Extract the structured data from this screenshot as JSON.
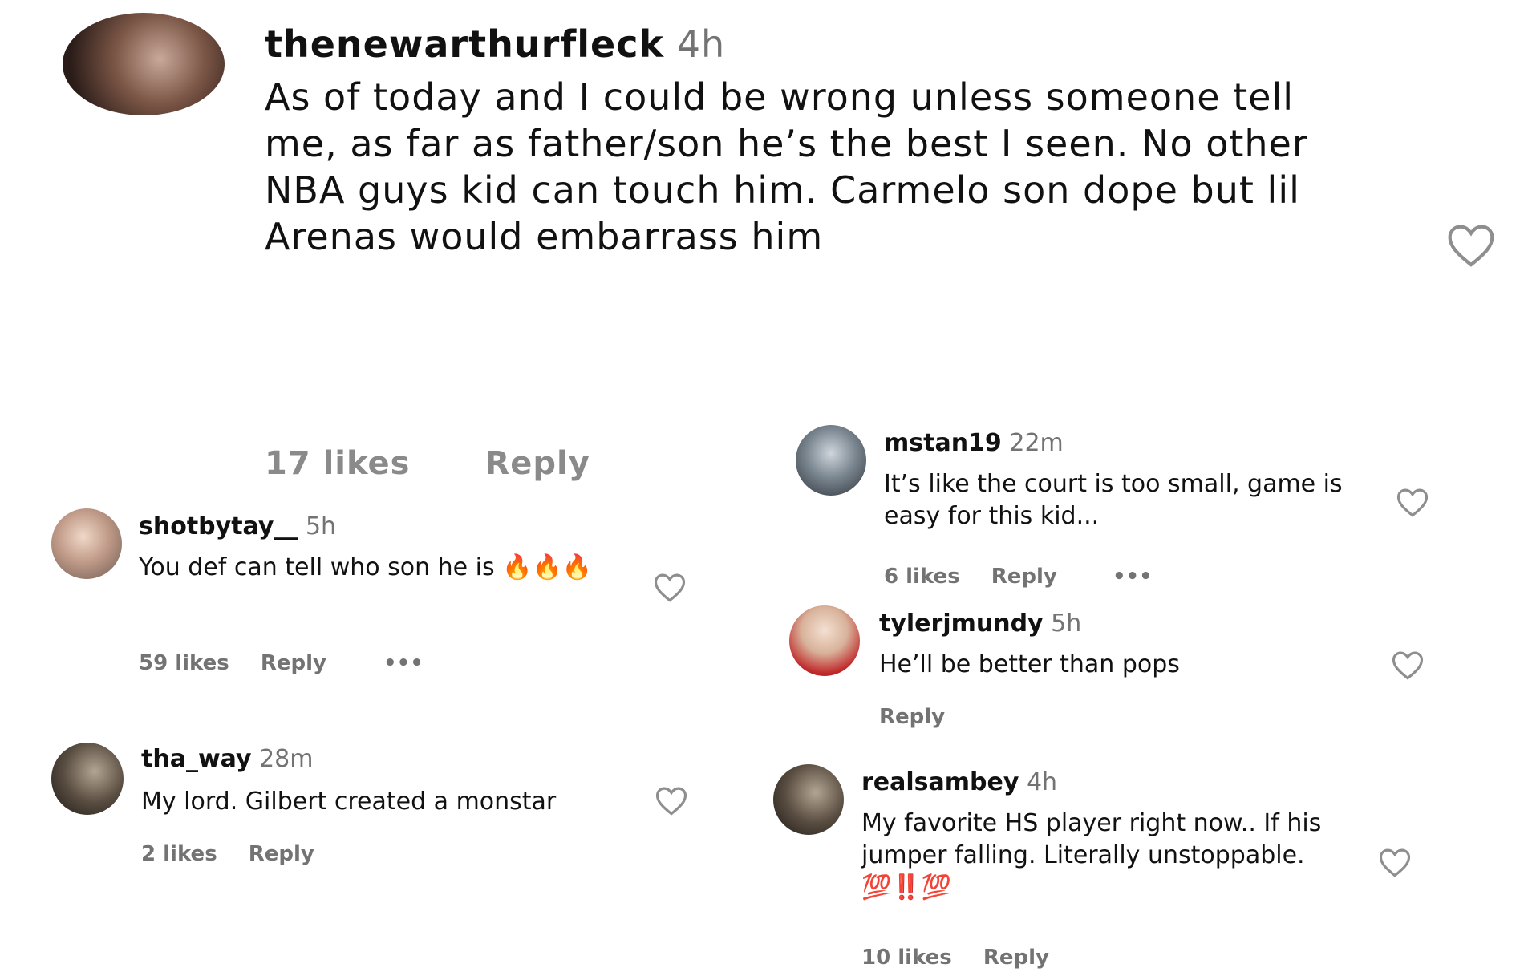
{
  "comments": [
    {
      "username": "thenewarthurfleck",
      "time": "4h",
      "text": "As of today and I could be wrong unless someone tell me, as far as father/son he’s the best I seen. No other NBA guys kid can touch him. Carmelo son dope but lil Arenas would embarrass him",
      "likes": "17 likes",
      "reply": "Reply"
    },
    {
      "username": "shotbytay__",
      "time": "5h",
      "text": "You def can tell who son he is",
      "emoji": "🔥🔥🔥",
      "likes": "59 likes",
      "reply": "Reply",
      "more": "•••"
    },
    {
      "username": "tha_way",
      "time": "28m",
      "text": "My lord. Gilbert created a monstar",
      "likes": "2 likes",
      "reply": "Reply"
    },
    {
      "username": "mstan19",
      "time": "22m",
      "text": "It’s like the court is too small, game is easy for this kid...",
      "likes": "6 likes",
      "reply": "Reply",
      "more": "•••"
    },
    {
      "username": "tylerjmundy",
      "time": "5h",
      "text": "He’ll be better than pops",
      "reply": "Reply"
    },
    {
      "username": "realsambey",
      "time": "4h",
      "text": "My favorite HS player right now.. If his jumper falling. Literally unstoppable.",
      "emoji": "💯‼️💯",
      "likes": "10 likes",
      "reply": "Reply"
    }
  ],
  "icons": {
    "like": "heart-outline-icon",
    "more": "more-dots-icon"
  },
  "colors": {
    "text": "#111111",
    "muted": "#737373",
    "heart_stroke": "#8e8e8e"
  }
}
